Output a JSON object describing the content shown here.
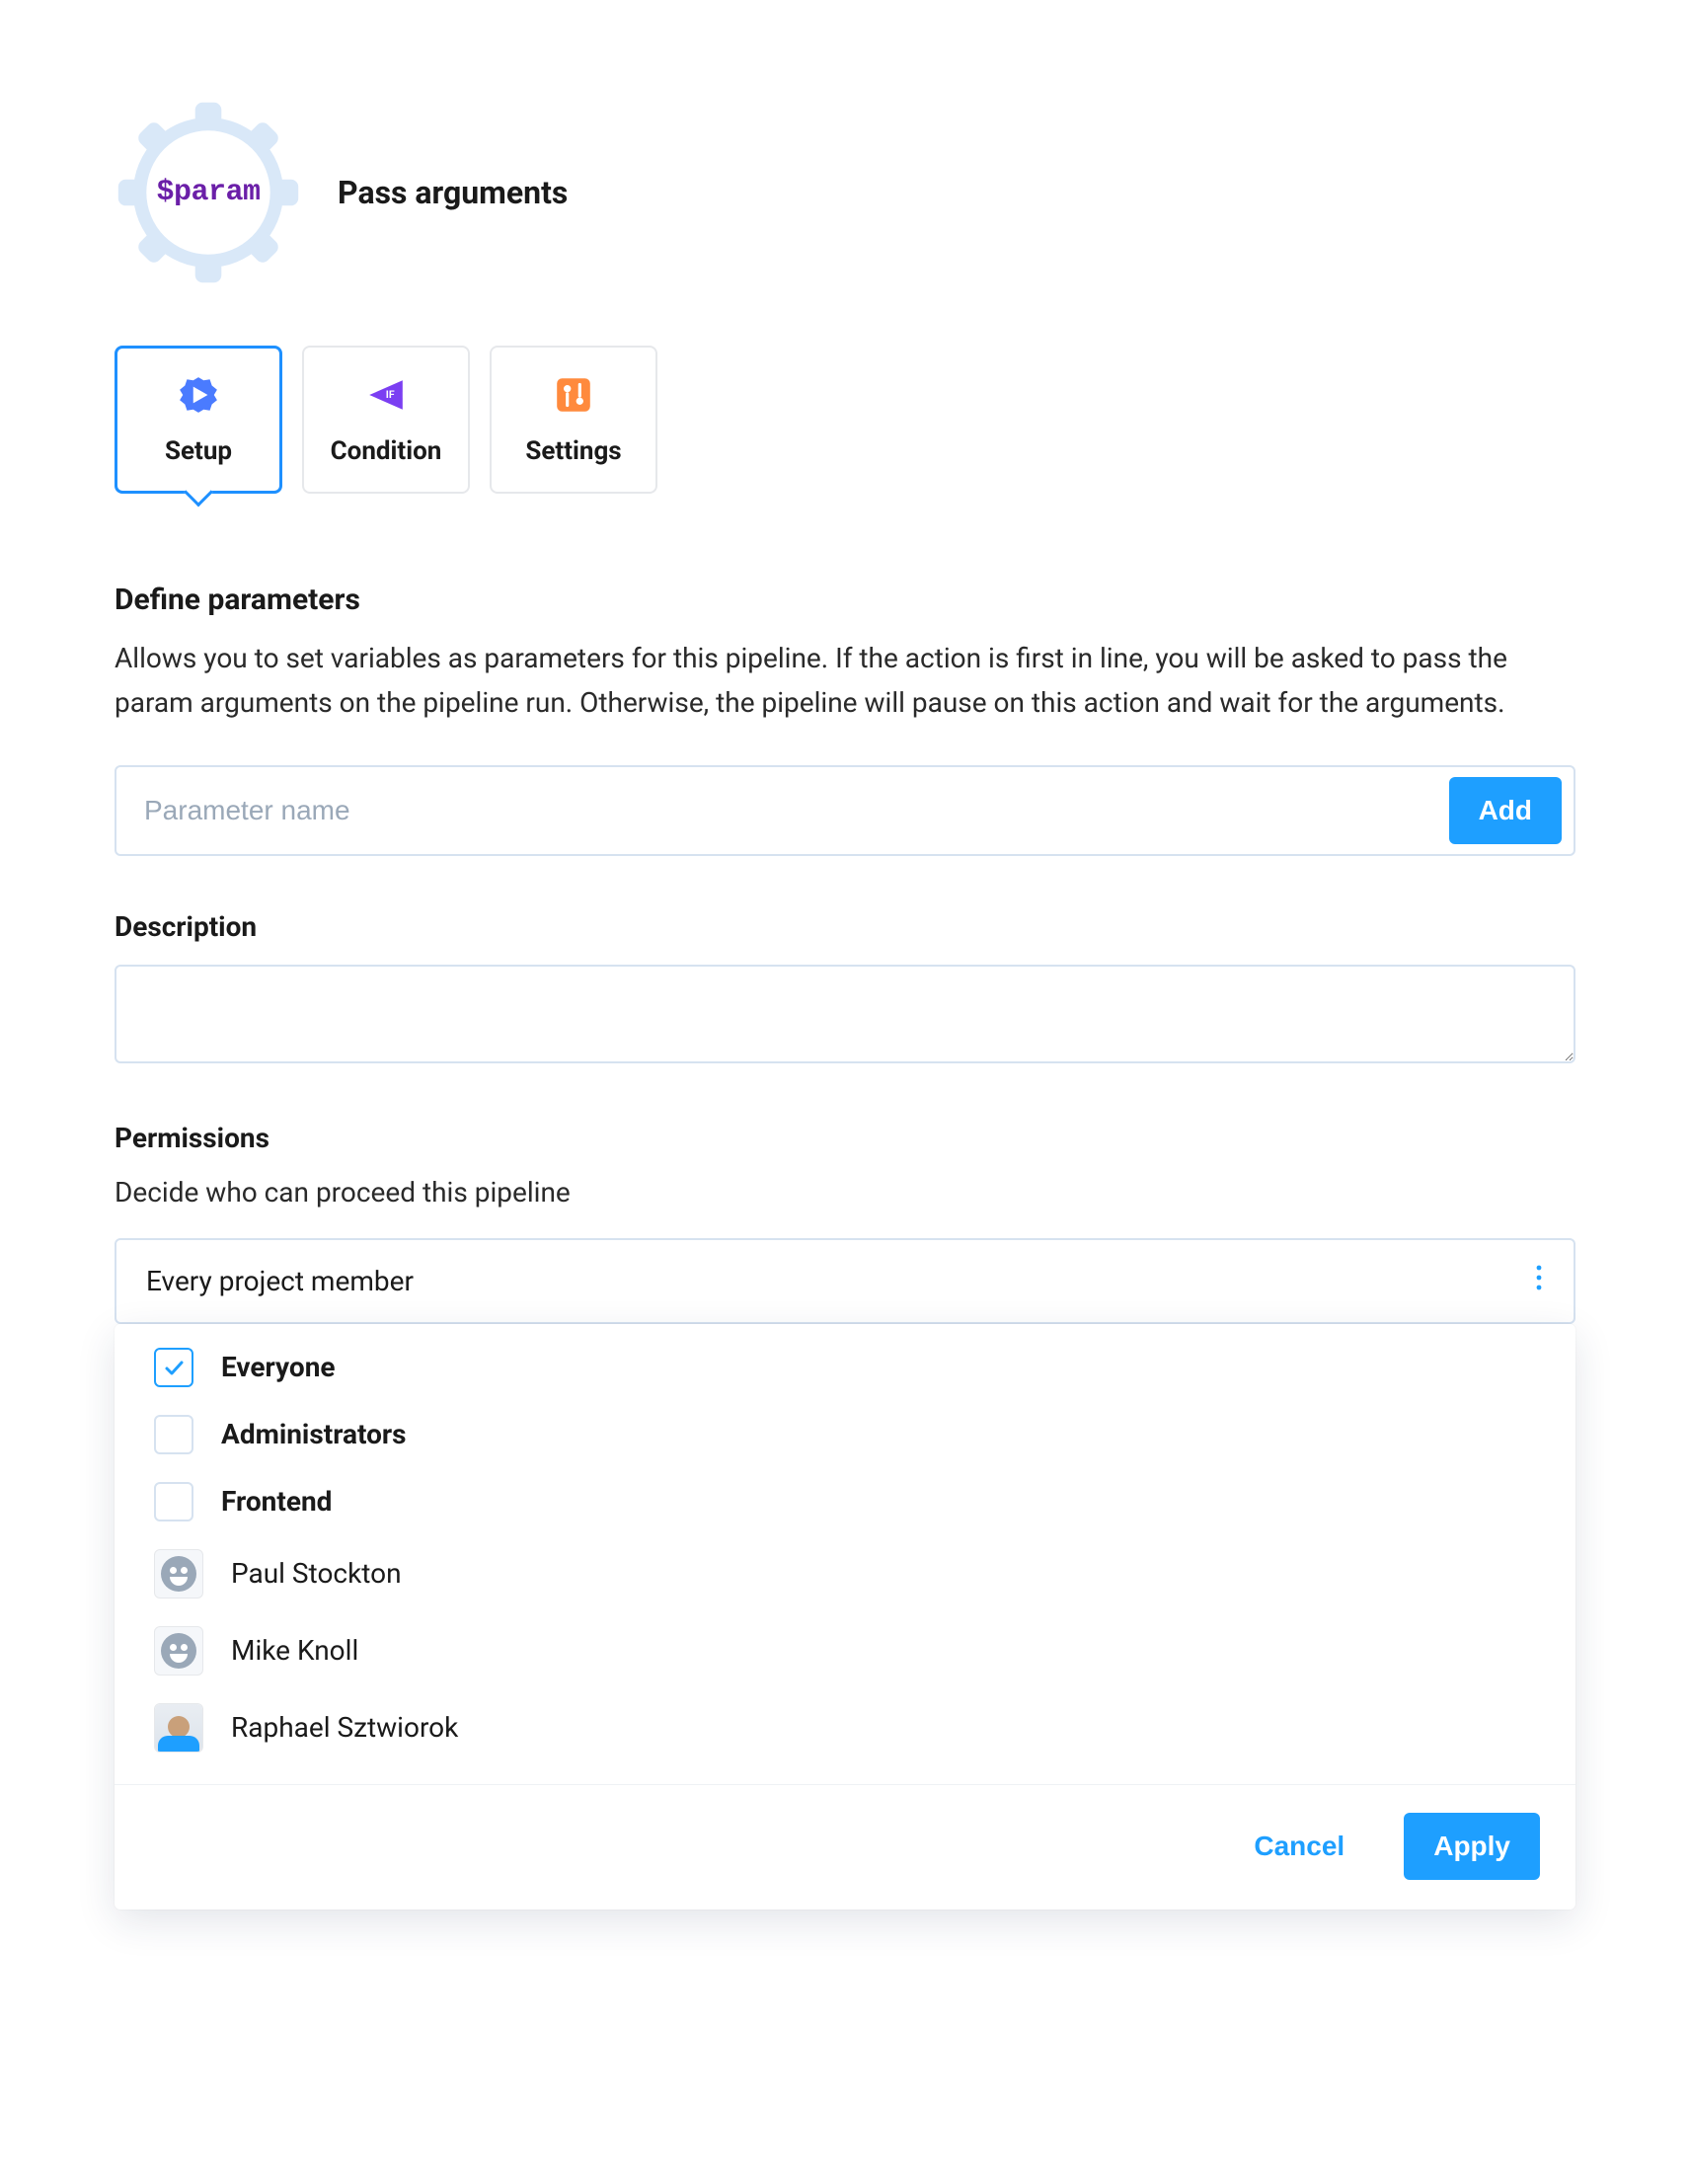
{
  "header": {
    "badge_text": "$param",
    "title": "Pass arguments"
  },
  "tabs": [
    {
      "label": "Setup",
      "icon": "setup-icon",
      "active": true
    },
    {
      "label": "Condition",
      "icon": "condition-icon",
      "active": false
    },
    {
      "label": "Settings",
      "icon": "settings-icon",
      "active": false
    }
  ],
  "define": {
    "heading": "Define parameters",
    "description": "Allows you to set variables as parameters for this pipeline. If the action is first in line, you will be asked to pass the param arguments on the pipeline run. Otherwise, the pipeline will pause on this action and wait for the arguments.",
    "input_placeholder": "Parameter name",
    "add_label": "Add"
  },
  "description_field": {
    "label": "Description",
    "value": ""
  },
  "permissions": {
    "label": "Permissions",
    "subtext": "Decide who can proceed this pipeline",
    "selected_text": "Every project member",
    "options": {
      "groups": [
        {
          "label": "Everyone",
          "checked": true
        },
        {
          "label": "Administrators",
          "checked": false
        },
        {
          "label": "Frontend",
          "checked": false
        }
      ],
      "users": [
        {
          "label": "Paul Stockton",
          "avatar": "generic"
        },
        {
          "label": "Mike Knoll",
          "avatar": "generic"
        },
        {
          "label": "Raphael Sztwiorok",
          "avatar": "photo"
        }
      ]
    },
    "cancel_label": "Cancel",
    "apply_label": "Apply"
  },
  "colors": {
    "accent_blue": "#1e9fff",
    "gear_fill": "#d9e8f8",
    "purple": "#6b1fa8",
    "orange": "#ff8a3d"
  }
}
